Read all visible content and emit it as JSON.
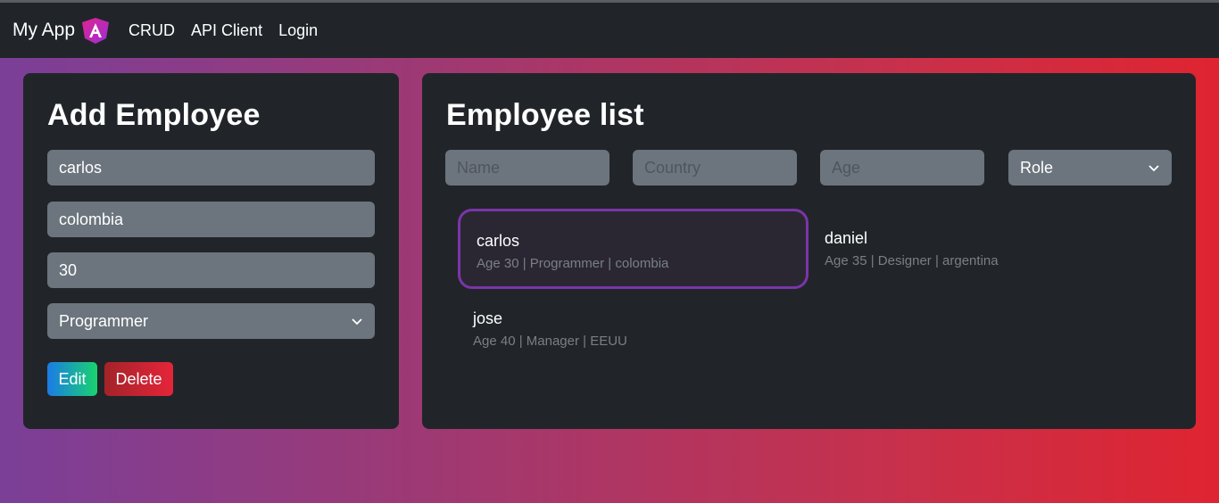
{
  "navbar": {
    "brand": "My App",
    "links": [
      "CRUD",
      "API Client",
      "Login"
    ]
  },
  "add_form": {
    "title": "Add Employee",
    "name_value": "carlos",
    "country_value": "colombia",
    "age_value": "30",
    "role_value": "Programmer",
    "edit_label": "Edit",
    "delete_label": "Delete"
  },
  "list": {
    "title": "Employee list",
    "filters": {
      "name_placeholder": "Name",
      "country_placeholder": "Country",
      "age_placeholder": "Age",
      "role_value": "Role"
    },
    "employees": [
      {
        "name": "carlos",
        "meta": "Age 30 | Programmer | colombia",
        "selected": true
      },
      {
        "name": "daniel",
        "meta": "Age 35 | Designer | argentina",
        "selected": false
      },
      {
        "name": "jose",
        "meta": "Age 40 | Manager | EEUU",
        "selected": false
      }
    ]
  },
  "colors": {
    "panel": "#212529",
    "input": "#6c757d",
    "selected_border": "#7a35a8",
    "edit_gradient": [
      "#1b7be6",
      "#19d36f"
    ],
    "delete_gradient": [
      "#a32328",
      "#e5253a"
    ]
  },
  "icons": {
    "logo": "angular-logo-icon",
    "dropdown": "chevron-down-icon"
  }
}
